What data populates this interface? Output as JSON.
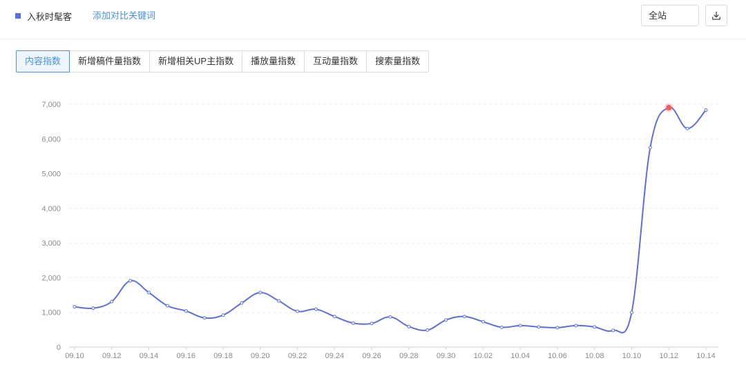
{
  "legend": {
    "series_label": "入秋时髦客",
    "series_color": "#5b6ee1"
  },
  "toolbar": {
    "add_compare_label": "添加对比关键词",
    "site_select_value": "全站",
    "download_icon": "download-icon"
  },
  "tabs": [
    {
      "label": "内容指数",
      "active": true
    },
    {
      "label": "新增稿件量指数",
      "active": false
    },
    {
      "label": "新增相关UP主指数",
      "active": false
    },
    {
      "label": "播放量指数",
      "active": false
    },
    {
      "label": "互动量指数",
      "active": false
    },
    {
      "label": "搜索量指数",
      "active": false
    }
  ],
  "chart_data": {
    "type": "line",
    "x": [
      "09.10",
      "09.11",
      "09.12",
      "09.13",
      "09.14",
      "09.15",
      "09.16",
      "09.17",
      "09.18",
      "09.19",
      "09.20",
      "09.21",
      "09.22",
      "09.23",
      "09.24",
      "09.25",
      "09.26",
      "09.27",
      "09.28",
      "09.29",
      "09.30",
      "10.01",
      "10.02",
      "10.03",
      "10.04",
      "10.05",
      "10.06",
      "10.07",
      "10.08",
      "10.09",
      "10.10",
      "10.11",
      "10.12",
      "10.13",
      "10.14"
    ],
    "x_tick_labels": [
      "09.10",
      "09.12",
      "09.14",
      "09.16",
      "09.18",
      "09.20",
      "09.22",
      "09.24",
      "09.26",
      "09.28",
      "09.30",
      "10.02",
      "10.04",
      "10.06",
      "10.08",
      "10.10",
      "10.12",
      "10.14"
    ],
    "series": [
      {
        "values": [
          1160,
          1120,
          1310,
          1910,
          1570,
          1190,
          1040,
          840,
          920,
          1270,
          1570,
          1330,
          1030,
          1090,
          880,
          690,
          680,
          870,
          590,
          490,
          780,
          880,
          730,
          570,
          620,
          580,
          560,
          620,
          580,
          480,
          1000,
          5750,
          6900,
          6300,
          6830
        ],
        "color": "#5b6ee1"
      }
    ],
    "highlight_index": 32,
    "highlight_color": "#f15c5c",
    "ylim": [
      0,
      7000
    ],
    "y_ticks": [
      0,
      1000,
      2000,
      3000,
      4000,
      5000,
      6000,
      7000
    ],
    "y_tick_labels": [
      "0",
      "1,000",
      "2,000",
      "3,000",
      "4,000",
      "5,000",
      "6,000",
      "7,000"
    ],
    "grid": true
  }
}
